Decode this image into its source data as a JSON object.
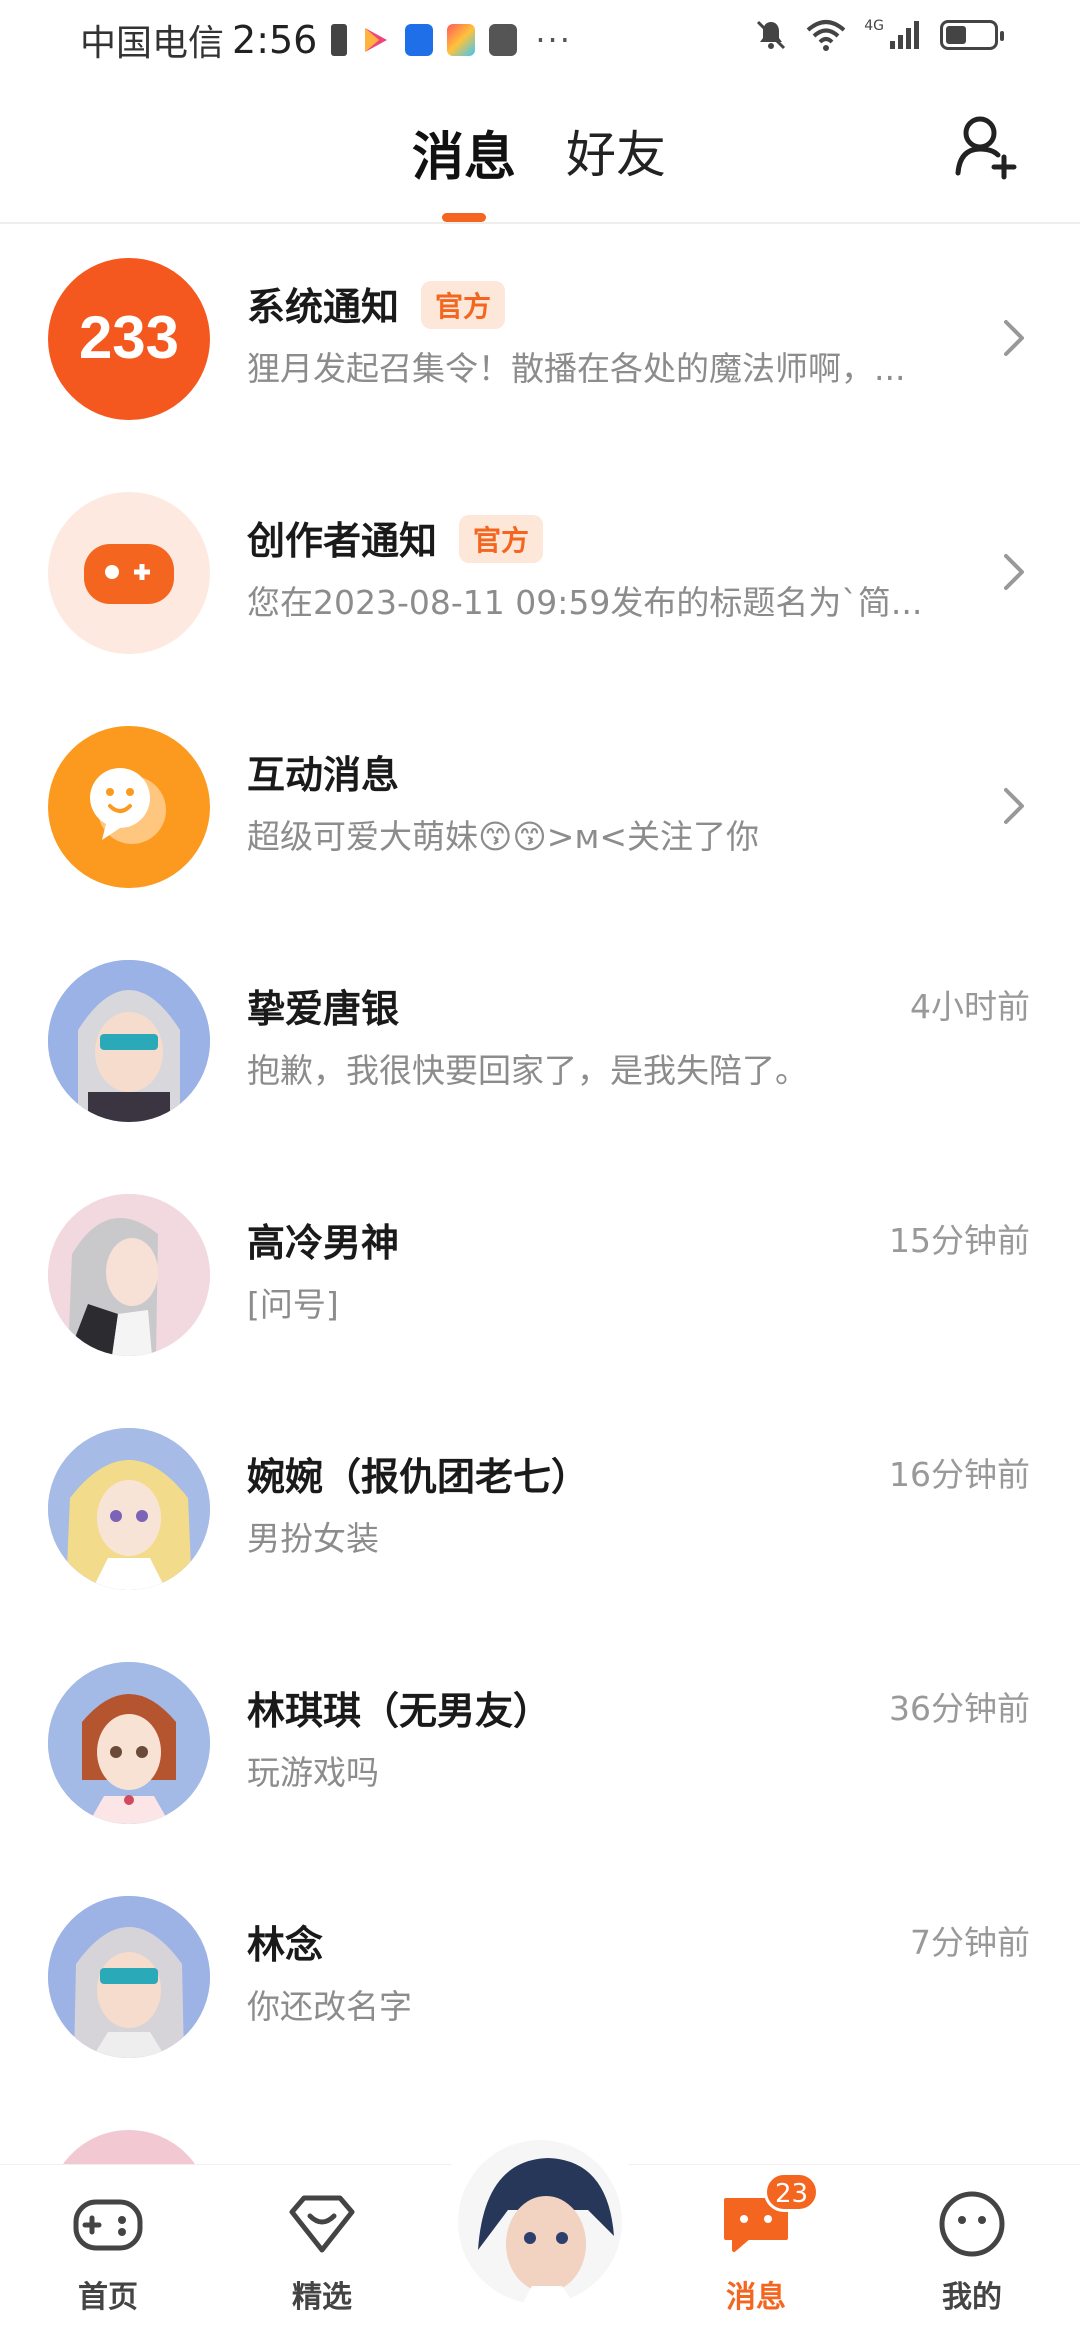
{
  "status_bar": {
    "carrier": "中国电信",
    "time": "2:56",
    "network": "4G"
  },
  "header": {
    "tabs": [
      {
        "label": "消息",
        "active": true
      },
      {
        "label": "好友",
        "active": false
      }
    ],
    "accent_color": "#f4661f"
  },
  "messages": [
    {
      "title": "系统通知",
      "badge": "官方",
      "subtitle": "狸月发起召集令！散播在各处的魔法师啊，...",
      "time": "",
      "avatar": "logo-233-icon"
    },
    {
      "title": "创作者通知",
      "badge": "官方",
      "subtitle": "您在2023-08-11 09:59发布的标题名为`简...",
      "time": "",
      "avatar": "gamepad-icon"
    },
    {
      "title": "互动消息",
      "badge": "",
      "subtitle": "超级可爱大萌妹😙😙>ᴍ<关注了你",
      "time": "",
      "avatar": "chat-bubble-icon"
    },
    {
      "title": "挚爱唐银",
      "badge": "",
      "subtitle": "抱歉，我很快要回家了，是我失陪了。",
      "time": "4小时前",
      "avatar": "user-avatar"
    },
    {
      "title": "高冷男神",
      "badge": "",
      "subtitle": "[问号]",
      "time": "15分钟前",
      "avatar": "user-avatar"
    },
    {
      "title": "婉婉（报仇团老七）",
      "badge": "",
      "subtitle": "男扮女装",
      "time": "16分钟前",
      "avatar": "user-avatar"
    },
    {
      "title": "林琪琪（无男友）",
      "badge": "",
      "subtitle": "玩游戏吗",
      "time": "36分钟前",
      "avatar": "user-avatar"
    },
    {
      "title": "林念",
      "badge": "",
      "subtitle": "你还改名字",
      "time": "7分钟前",
      "avatar": "user-avatar"
    }
  ],
  "bottom_nav": {
    "items": [
      {
        "label": "首页",
        "icon": "gamepad-icon"
      },
      {
        "label": "精选",
        "icon": "heart-diamond-icon"
      },
      {
        "label": "消息",
        "icon": "chat-icon",
        "active": true
      },
      {
        "label": "我的",
        "icon": "face-icon"
      }
    ],
    "unread_count": "23"
  }
}
